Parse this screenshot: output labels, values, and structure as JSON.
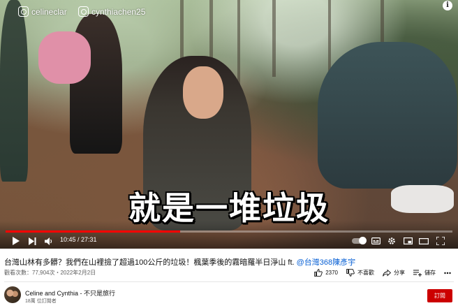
{
  "watermark": {
    "handle_1": "celineclar",
    "handle_2": "cynthiachen25"
  },
  "subtitle": "就是一堆垃圾",
  "player": {
    "time": "10:45 / 27:31",
    "progress": 0.39,
    "icons": [
      "play-icon",
      "next-icon",
      "volume-icon",
      "autoplay-toggle",
      "subtitles-icon",
      "settings-icon",
      "miniplayer-icon",
      "theater-icon",
      "fullscreen-icon"
    ]
  },
  "video": {
    "title_text": "台灣山林有多髒？我們在山裡撿了超過100公斤的垃圾！楓葉季後的霧暗羅半日淨山 ft. ",
    "title_link": "@台灣368陳彥宇",
    "meta": "觀看次數：77,904次・2022年2月2日"
  },
  "actions": {
    "like_count": "2370",
    "dislike_label": "不喜歡",
    "share_label": "分享",
    "save_label": "儲存"
  },
  "channel": {
    "name": "Celine and Cynthia - 不只是旅行",
    "subscribers": "18萬 位訂閱者",
    "subscribe_label": "訂閱"
  },
  "colors": {
    "progress": "#ff0000",
    "subscribe": "#cc0000",
    "link": "#065fd4"
  }
}
